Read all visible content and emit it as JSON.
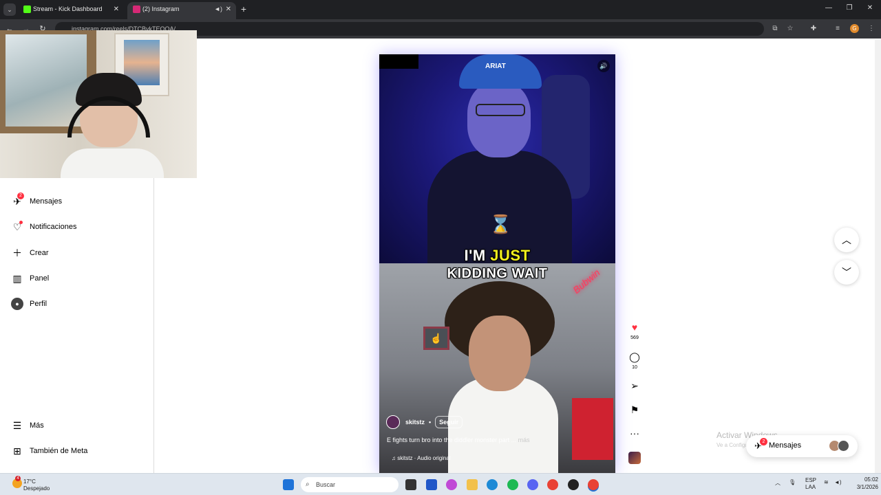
{
  "browser": {
    "tabs": [
      {
        "title": "Stream - Kick Dashboard",
        "icon": "kick-icon",
        "color": "#53fc18"
      },
      {
        "title": "(2) Instagram",
        "icon": "instagram-icon",
        "color": "#d62976"
      }
    ],
    "url": "instagram.com/reels/DTCBvkTEQOA/"
  },
  "sidebar": {
    "items": [
      {
        "label": "Mensajes",
        "icon": "messenger-icon",
        "badge": "2"
      },
      {
        "label": "Notificaciones",
        "icon": "heart-icon"
      },
      {
        "label": "Crear",
        "icon": "plus-icon"
      },
      {
        "label": "Panel",
        "icon": "chart-icon"
      },
      {
        "label": "Perfil",
        "icon": "profile-avatar"
      },
      {
        "label": "Más",
        "icon": "menu-icon"
      },
      {
        "label": "También de Meta",
        "icon": "meta-grid-icon"
      }
    ]
  },
  "reel": {
    "caption_line1_a": "I'M",
    "caption_line1_b": "JUST",
    "caption_line2": "KIDDING WAIT",
    "neon_text": "Bubwin",
    "author": "skitstz",
    "separator": "•",
    "follow_label": "Seguir",
    "description": "E fights turn bro into the diddler monster part ...",
    "more_label": "más",
    "audio": "skitstz · Audio original",
    "likes": "569",
    "comments": "10",
    "caption_highlight_color": "#f3f01e"
  },
  "overlay": {
    "activate_title": "Activar Windows",
    "activate_sub": "Ve a Configuración para activar Windows.",
    "messages_label": "Mensajes",
    "messages_badge": "2"
  },
  "taskbar": {
    "weather_badge": "4",
    "temperature": "17°C",
    "condition": "Despejado",
    "search_placeholder": "Buscar",
    "language_1": "ESP",
    "language_2": "LAA",
    "time": "05:02",
    "date": "3/1/2026"
  }
}
